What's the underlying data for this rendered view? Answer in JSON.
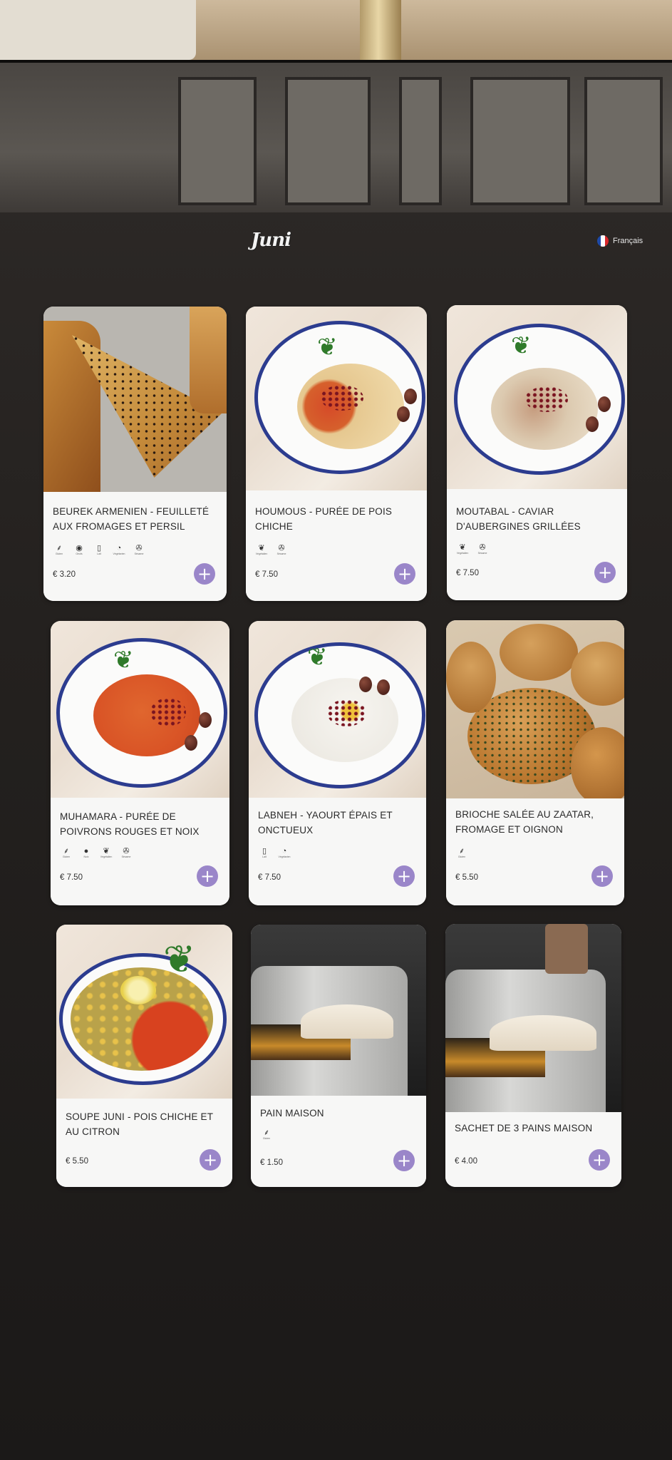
{
  "header": {
    "logo_text": "Juni",
    "language_label": "Français",
    "flag_colors": [
      "#1f4aa8",
      "#ffffff",
      "#d8282c"
    ]
  },
  "theme": {
    "accent": "#9a86c9",
    "card_bg": "#f7f7f6",
    "plate_rim": "#2c3c8f"
  },
  "products": [
    {
      "name": "BEUREK ARMENIEN - FEUILLETÉ AUX FROMAGES ET PERSIL",
      "price": "€ 3.20",
      "tags": [
        {
          "icon": "wheat-icon",
          "glyph": "⸙",
          "caption": "Gluten"
        },
        {
          "icon": "egg-icon",
          "glyph": "◉",
          "caption": "Oeufs"
        },
        {
          "icon": "milk-icon",
          "glyph": "▯",
          "caption": "Lait"
        },
        {
          "icon": "vegetarian-icon",
          "glyph": "◔",
          "caption": "Végétarien"
        },
        {
          "icon": "sesame-icon",
          "glyph": "✇",
          "caption": "Sésame"
        }
      ]
    },
    {
      "name": "HOUMOUS - PURÉE DE POIS CHICHE",
      "price": "€ 7.50",
      "tags": [
        {
          "icon": "vegan-icon",
          "glyph": "❦",
          "caption": "Végétalien"
        },
        {
          "icon": "sesame-icon",
          "glyph": "✇",
          "caption": "Sésame"
        }
      ]
    },
    {
      "name": "MOUTABAL - CAVIAR D'AUBERGINES GRILLÉES",
      "price": "€ 7.50",
      "tags": [
        {
          "icon": "vegan-icon",
          "glyph": "❦",
          "caption": "Végétalien"
        },
        {
          "icon": "sesame-icon",
          "glyph": "✇",
          "caption": "Sésame"
        }
      ]
    },
    {
      "name": "MUHAMARA - PURÉE DE POIVRONS ROUGES ET NOIX",
      "price": "€ 7.50",
      "tags": [
        {
          "icon": "wheat-icon",
          "glyph": "⸙",
          "caption": "Gluten"
        },
        {
          "icon": "nut-icon",
          "glyph": "●",
          "caption": "Noix"
        },
        {
          "icon": "vegan-icon",
          "glyph": "❦",
          "caption": "Végétalien"
        },
        {
          "icon": "sesame-icon",
          "glyph": "✇",
          "caption": "Sésame"
        }
      ]
    },
    {
      "name": "LABNEH - YAOURT ÉPAIS ET ONCTUEUX",
      "price": "€ 7.50",
      "tags": [
        {
          "icon": "milk-icon",
          "glyph": "▯",
          "caption": "Lait"
        },
        {
          "icon": "vegetarian-icon",
          "glyph": "◔",
          "caption": "Végétarien"
        }
      ]
    },
    {
      "name": "BRIOCHE SALÉE AU ZAATAR, FROMAGE ET OIGNON",
      "price": "€ 5.50",
      "tags": [
        {
          "icon": "wheat-icon",
          "glyph": "⸙",
          "caption": "Gluten"
        }
      ]
    },
    {
      "name": "SOUPE JUNI - POIS CHICHE ET AU CITRON",
      "price": "€ 5.50",
      "tags": []
    },
    {
      "name": "PAIN MAISON",
      "price": "€ 1.50",
      "tags": [
        {
          "icon": "wheat-icon",
          "glyph": "⸙",
          "caption": "Gluten"
        }
      ]
    },
    {
      "name": "SACHET DE 3 PAINS MAISON",
      "price": "€ 4.00",
      "tags": []
    }
  ]
}
